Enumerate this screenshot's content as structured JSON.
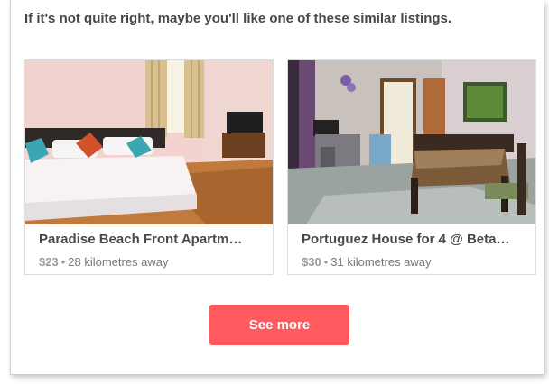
{
  "section": {
    "heading": "If it's not quite right, maybe you'll like one of these similar listings."
  },
  "listings": [
    {
      "title": "Paradise Beach Front Apartm…",
      "price": "$23",
      "separator": "•",
      "distance": "28 kilometres away"
    },
    {
      "title": "Portuguez House for 4 @ Beta…",
      "price": "$30",
      "separator": "•",
      "distance": "31 kilometres away"
    }
  ],
  "actions": {
    "see_more_label": "See more"
  },
  "colors": {
    "accent": "#ff5a5f",
    "text": "#484848",
    "muted": "#767676"
  }
}
